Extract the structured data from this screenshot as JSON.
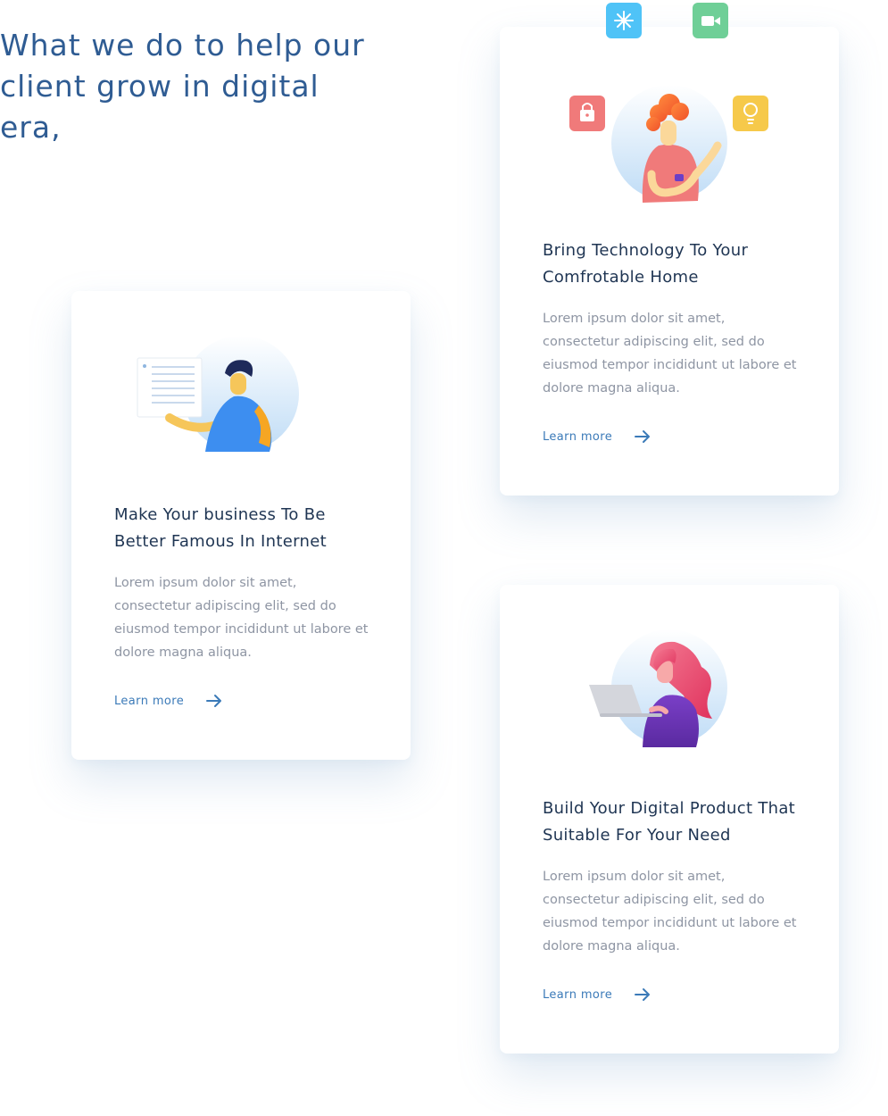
{
  "hero": {
    "title": "What we do to help our client grow in digital era,"
  },
  "colors": {
    "heading": "#2f5c93",
    "card_title": "#1f3553",
    "body_text": "#8e95a3",
    "link": "#3b7ab8"
  },
  "cards": [
    {
      "illustration": "man-holding-document-illustration",
      "title": "Make Your business To Be Better Famous In Internet",
      "text": "Lorem ipsum dolor sit amet, consectetur adipiscing elit, sed do eiusmod tempor incididunt ut labore et dolore magna aliqua.",
      "link_label": "Learn more",
      "link_icon": "arrow-right-icon"
    },
    {
      "illustration": "woman-smart-home-illustration",
      "icons": [
        "snowflake-icon",
        "video-camera-icon",
        "lock-icon",
        "lightbulb-icon"
      ],
      "title": "Bring Technology To Your Comfrotable Home",
      "text": "Lorem ipsum dolor sit amet, consectetur adipiscing elit, sed do eiusmod tempor incididunt ut labore et dolore magna aliqua.",
      "link_label": "Learn more",
      "link_icon": "arrow-right-icon"
    },
    {
      "illustration": "woman-with-laptop-illustration",
      "title": "Build Your Digital Product That Suitable For Your Need",
      "text": "Lorem ipsum dolor sit amet, consectetur adipiscing elit, sed do eiusmod tempor incididunt ut labore et dolore magna aliqua.",
      "link_label": "Learn more",
      "link_icon": "arrow-right-icon"
    }
  ]
}
